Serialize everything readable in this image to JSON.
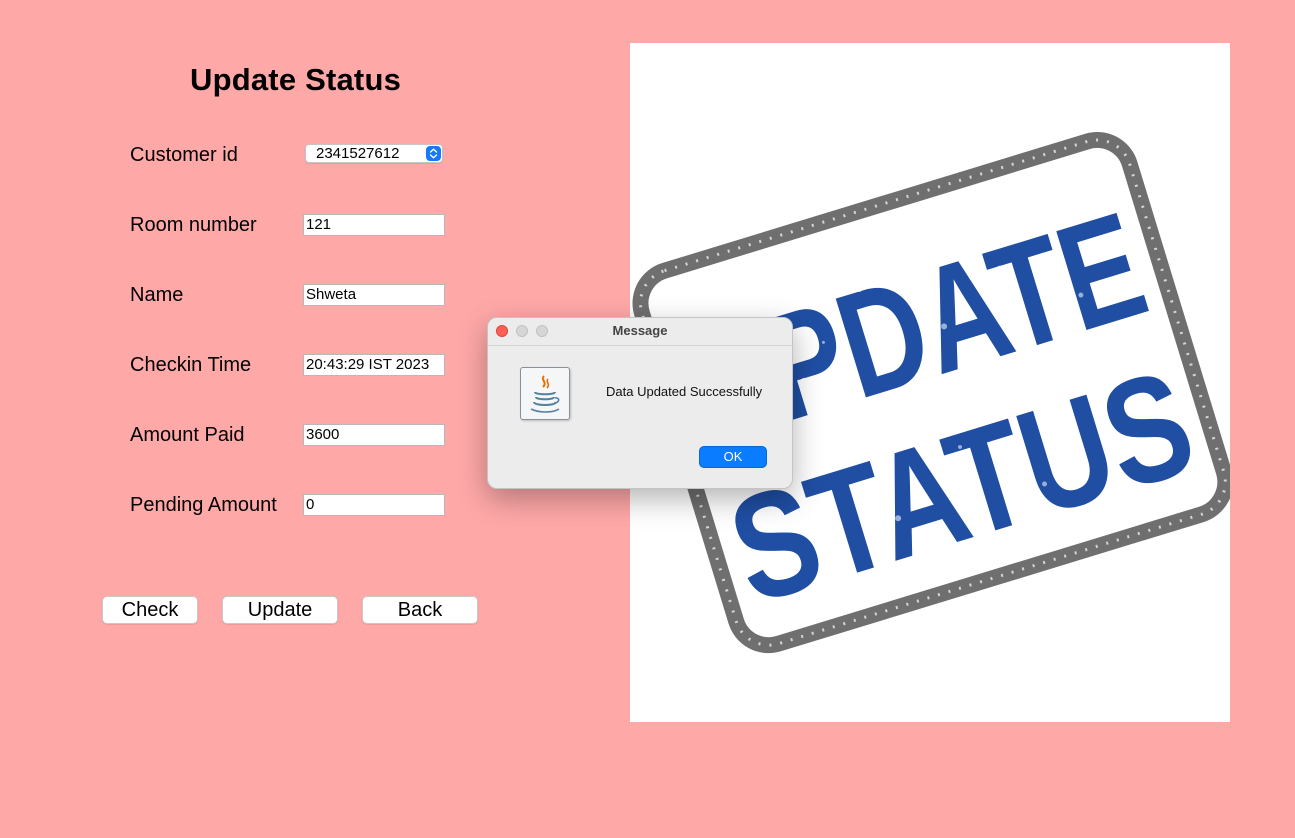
{
  "form": {
    "title": "Update Status",
    "labels": {
      "customer_id": "Customer id",
      "room_number": "Room number",
      "name": "Name",
      "checkin_time": "Checkin Time",
      "amount_paid": "Amount Paid",
      "pending_amount": "Pending Amount"
    },
    "values": {
      "customer_id": "2341527612",
      "room_number": "121",
      "name": "Shweta",
      "checkin_time": "20:43:29 IST 2023",
      "amount_paid": "3600",
      "pending_amount": "0"
    },
    "buttons": {
      "check": "Check",
      "update": "Update",
      "back": "Back"
    }
  },
  "stamp": {
    "line1": "UPDATE",
    "line2": "STATUS",
    "ink_color": "#1f4ea3",
    "border_color": "#6f6f6f"
  },
  "dialog": {
    "title": "Message",
    "message": "Data Updated Successfully",
    "ok_label": "OK",
    "icon": "java-icon"
  },
  "colors": {
    "background": "#ffa8a8",
    "accent": "#0a7cff"
  }
}
